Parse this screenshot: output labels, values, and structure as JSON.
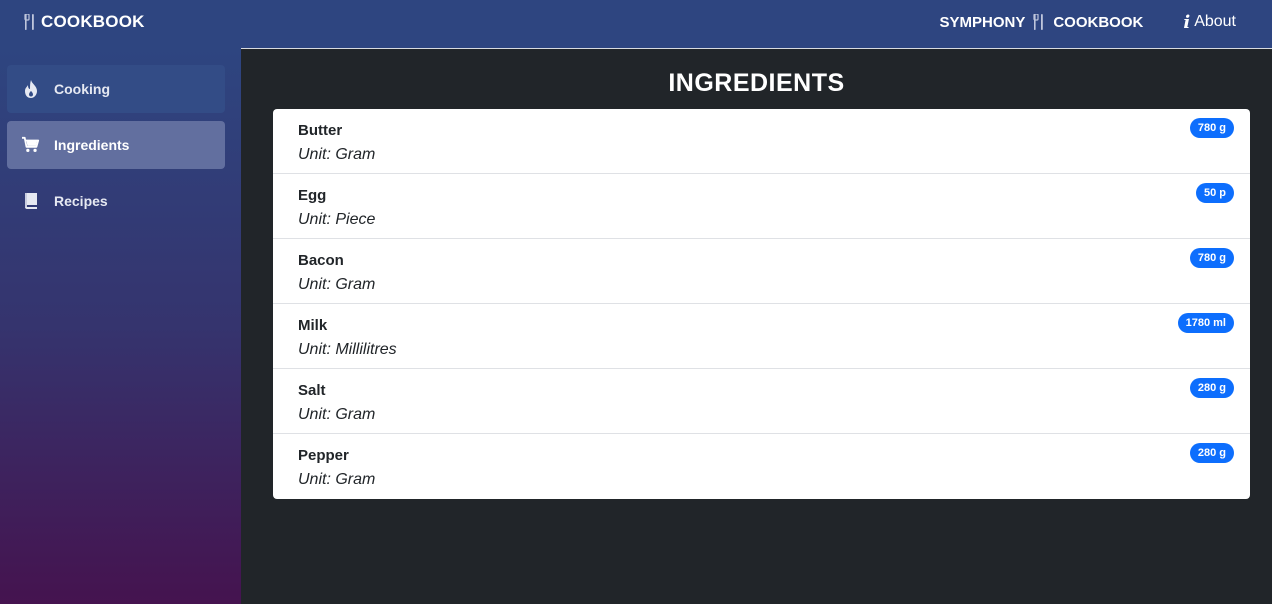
{
  "header": {
    "brand": "COOKBOOK",
    "symphony_label": "SYMPHONY",
    "cookbook_label": "COOKBOOK",
    "about_label": "About"
  },
  "sidebar": {
    "items": [
      {
        "label": "Cooking",
        "icon": "flame-icon"
      },
      {
        "label": "Ingredients",
        "icon": "cart-icon",
        "active": true
      },
      {
        "label": "Recipes",
        "icon": "book-icon"
      }
    ]
  },
  "main": {
    "title": "INGREDIENTS",
    "ingredients": [
      {
        "name": "Butter",
        "unit": "Unit: Gram",
        "amount": "780 g"
      },
      {
        "name": "Egg",
        "unit": "Unit: Piece",
        "amount": "50 p"
      },
      {
        "name": "Bacon",
        "unit": "Unit: Gram",
        "amount": "780 g"
      },
      {
        "name": "Milk",
        "unit": "Unit: Millilitres",
        "amount": "1780 ml"
      },
      {
        "name": "Salt",
        "unit": "Unit: Gram",
        "amount": "280 g"
      },
      {
        "name": "Pepper",
        "unit": "Unit: Gram",
        "amount": "280 g"
      }
    ]
  },
  "colors": {
    "header_bg": "#2e4580",
    "main_bg": "#212529",
    "badge_bg": "#0d6efd",
    "active_nav_bg": "#626f9f"
  }
}
